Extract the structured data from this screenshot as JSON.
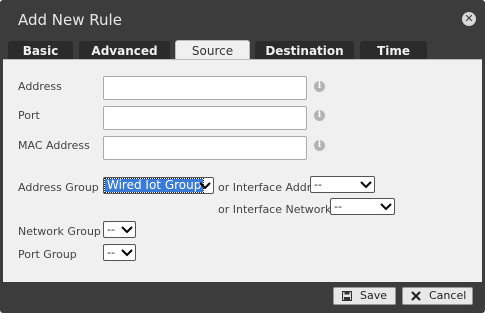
{
  "dialog": {
    "title": "Add New Rule"
  },
  "tabs": [
    "Basic",
    "Advanced",
    "Source",
    "Destination",
    "Time"
  ],
  "active_tab": "Source",
  "fields": {
    "address_label": "Address",
    "port_label": "Port",
    "mac_label": "MAC Address",
    "address_value": "",
    "port_value": "",
    "mac_value": ""
  },
  "address_group": {
    "label": "Address Group",
    "value": "Wired Iot Group",
    "or_interface_addr_label": "or Interface Addr",
    "interface_addr_value": "--",
    "or_interface_network_label": "or Interface Network",
    "interface_network_value": "--"
  },
  "network_group": {
    "label": "Network Group",
    "value": "--"
  },
  "port_group": {
    "label": "Port Group",
    "value": "--"
  },
  "buttons": {
    "save": "Save",
    "cancel": "Cancel"
  },
  "icons": {
    "info": "info-icon",
    "close": "close-icon",
    "save": "save-icon",
    "cancel": "cancel-icon"
  }
}
